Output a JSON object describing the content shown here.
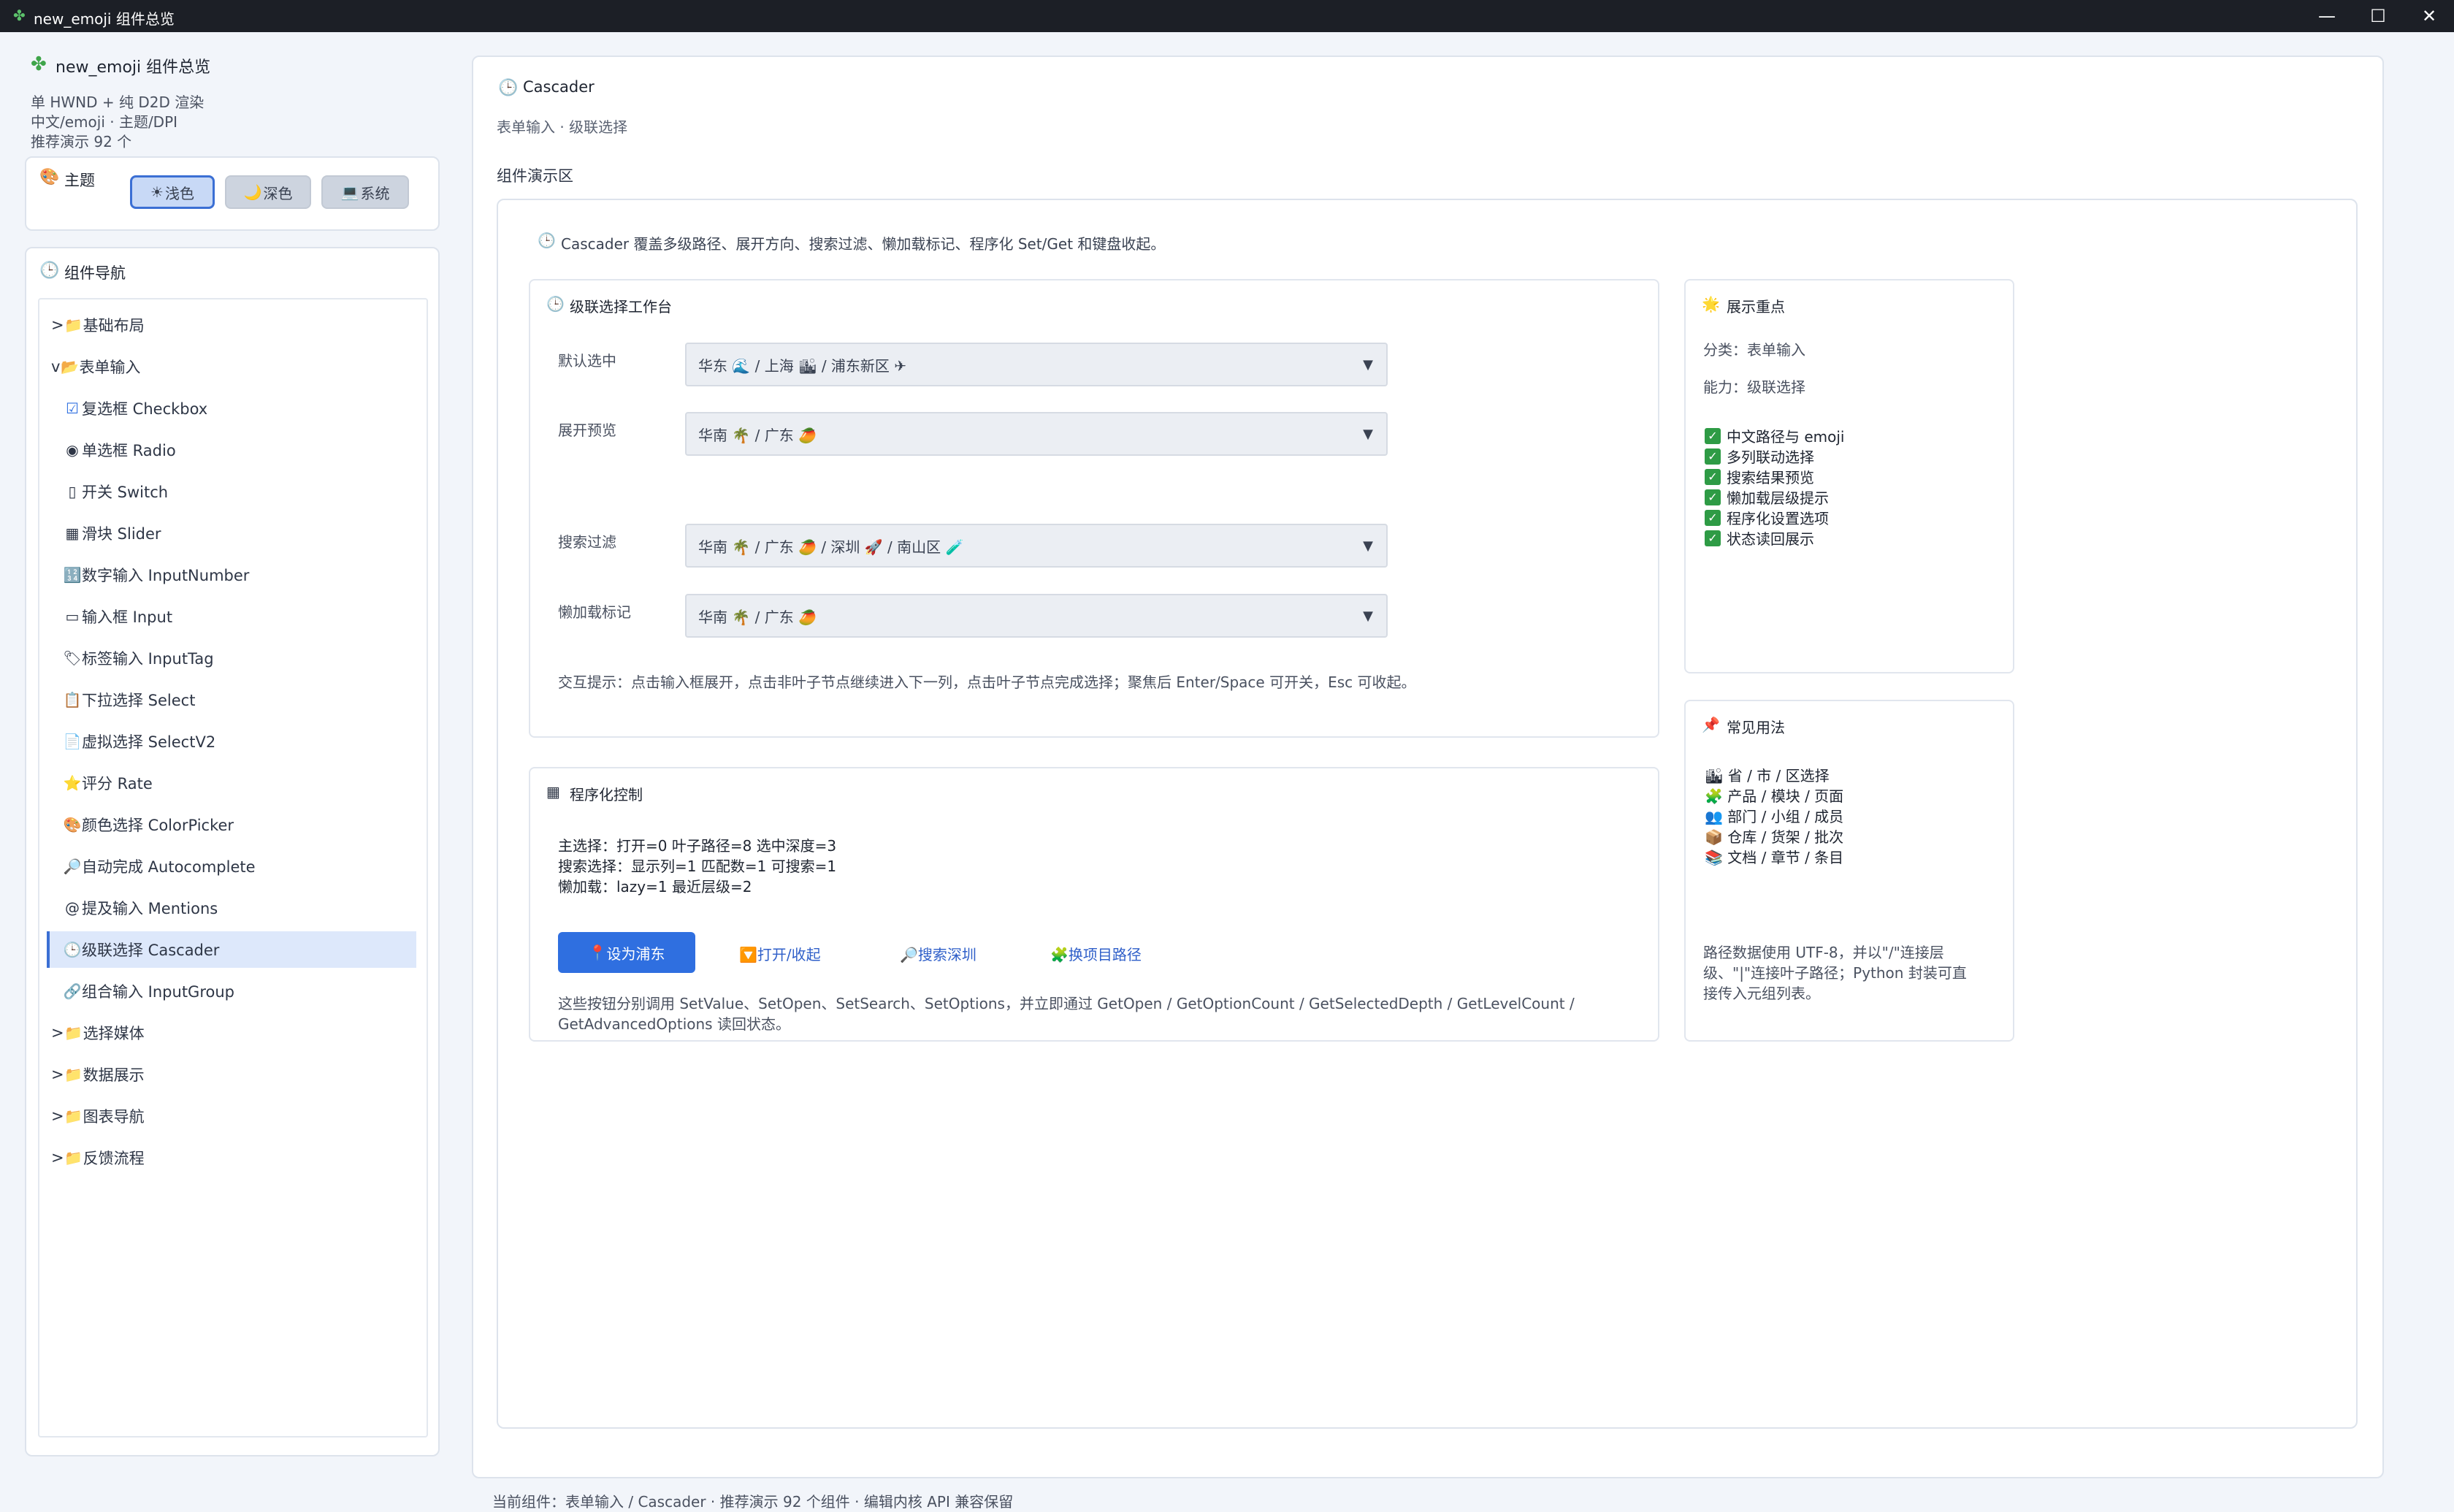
{
  "window": {
    "title": "new_emoji 组件总览",
    "app_icon": "clover-icon",
    "controls": {
      "minimize": "—",
      "maximize": "☐",
      "close": "✕"
    }
  },
  "sidebar": {
    "brand": "new_emoji 组件总览",
    "lines": [
      "单 HWND + 纯 D2D 渲染",
      "中文/emoji · 主题/DPI",
      "推荐演示 92 个"
    ],
    "theme": {
      "label": "主题",
      "buttons": [
        {
          "icon": "☀",
          "label": "浅色",
          "active": true
        },
        {
          "icon": "🌙",
          "label": "深色",
          "active": false
        },
        {
          "icon": "💻",
          "label": "系统",
          "active": false
        }
      ]
    },
    "nav_title": "组件导航",
    "nav": [
      {
        "prefix": ">",
        "icon": "📁",
        "label": "基础布局",
        "level": 0
      },
      {
        "prefix": "v",
        "icon": "📂",
        "label": "表单输入",
        "level": 0
      },
      {
        "prefix": "",
        "icon": "☑",
        "label": "复选框 Checkbox",
        "level": 1
      },
      {
        "prefix": "",
        "icon": "◉",
        "label": "单选框 Radio",
        "level": 1
      },
      {
        "prefix": "",
        "icon": "▯",
        "label": "开关 Switch",
        "level": 1
      },
      {
        "prefix": "",
        "icon": "▦",
        "label": "滑块 Slider",
        "level": 1
      },
      {
        "prefix": "",
        "icon": "🔢",
        "label": "数字输入 InputNumber",
        "level": 1
      },
      {
        "prefix": "",
        "icon": "▭",
        "label": "输入框 Input",
        "level": 1
      },
      {
        "prefix": "",
        "icon": "🏷",
        "label": "标签输入 InputTag",
        "level": 1
      },
      {
        "prefix": "",
        "icon": "📋",
        "label": "下拉选择 Select",
        "level": 1
      },
      {
        "prefix": "",
        "icon": "📄",
        "label": "虚拟选择 SelectV2",
        "level": 1
      },
      {
        "prefix": "",
        "icon": "⭐",
        "label": "评分 Rate",
        "level": 1
      },
      {
        "prefix": "",
        "icon": "🎨",
        "label": "颜色选择 ColorPicker",
        "level": 1
      },
      {
        "prefix": "",
        "icon": "🔎",
        "label": "自动完成 Autocomplete",
        "level": 1
      },
      {
        "prefix": "",
        "icon": "@",
        "label": "提及输入 Mentions",
        "level": 1
      },
      {
        "prefix": "",
        "icon": "🕒",
        "label": "级联选择 Cascader",
        "level": 1,
        "selected": true
      },
      {
        "prefix": "",
        "icon": "🔗",
        "label": "组合输入 InputGroup",
        "level": 1
      },
      {
        "prefix": ">",
        "icon": "📁",
        "label": "选择媒体",
        "level": 0
      },
      {
        "prefix": ">",
        "icon": "📁",
        "label": "数据展示",
        "level": 0
      },
      {
        "prefix": ">",
        "icon": "📁",
        "label": "图表导航",
        "level": 0
      },
      {
        "prefix": ">",
        "icon": "📁",
        "label": "反馈流程",
        "level": 0
      }
    ]
  },
  "main": {
    "title": "Cascader",
    "subtitle": "表单输入 · 级联选择",
    "section": "组件演示区",
    "intro": "Cascader 覆盖多级路径、展开方向、搜索过滤、懒加载标记、程序化 Set/Get 和键盘收起。",
    "workbench": {
      "title": "级联选择工作台",
      "rows": [
        {
          "label": "默认选中",
          "value": "华东 🌊 / 上海 🏙 / 浦东新区 ✈"
        },
        {
          "label": "展开预览",
          "value": "华南 🌴 / 广东 🥭"
        },
        {
          "label": "搜索过滤",
          "value": "华南 🌴 / 广东 🥭 / 深圳 🚀 / 南山区 🧪"
        },
        {
          "label": "懒加载标记",
          "value": "华南 🌴 / 广东 🥭"
        }
      ],
      "hint": "交互提示：点击输入框展开，点击非叶子节点继续进入下一列，点击叶子节点完成选择；聚焦后 Enter/Space 可开关，Esc 可收起。"
    },
    "programmatic": {
      "title": "程序化控制",
      "status": [
        "主选择：打开=0 叶子路径=8 选中深度=3",
        "搜索选择：显示列=1 匹配数=1 可搜索=1",
        "懒加载：lazy=1 最近层级=2"
      ],
      "primary": "设为浦东",
      "links": [
        {
          "icon": "🔽",
          "label": "打开/收起"
        },
        {
          "icon": "🔎",
          "label": "搜索深圳"
        },
        {
          "icon": "🧩",
          "label": "换项目路径"
        }
      ],
      "desc": [
        "这些按钮分别调用 SetValue、SetOpen、SetSearch、SetOptions，并立即通过 GetOpen / GetOptionCount / GetSelectedDepth / GetLevelCount /",
        "GetAdvancedOptions 读回状态。"
      ]
    },
    "focus": {
      "title": "展示重点",
      "category": "分类：表单输入",
      "ability": "能力：级联选择",
      "checks": [
        "中文路径与 emoji",
        "多列联动选择",
        "搜索结果预览",
        "懒加载层级提示",
        "程序化设置选项",
        "状态读回展示"
      ]
    },
    "usage": {
      "title": "常见用法",
      "items": [
        {
          "icon": "🏙",
          "label": "省 / 市 / 区选择"
        },
        {
          "icon": "🧩",
          "label": "产品 / 模块 / 页面"
        },
        {
          "icon": "👥",
          "label": "部门 / 小组 / 成员"
        },
        {
          "icon": "📦",
          "label": "仓库 / 货架 / 批次"
        },
        {
          "icon": "📚",
          "label": "文档 / 章节 / 条目"
        }
      ],
      "note": [
        "路径数据使用 UTF-8，并以\"/\"连接层",
        "级、\"|\"连接叶子路径；Python 封装可直",
        "接传入元组列表。"
      ]
    }
  },
  "footer": "当前组件：表单输入 / Cascader · 推荐演示 92 个组件 · 编辑内核 API 兼容保留"
}
